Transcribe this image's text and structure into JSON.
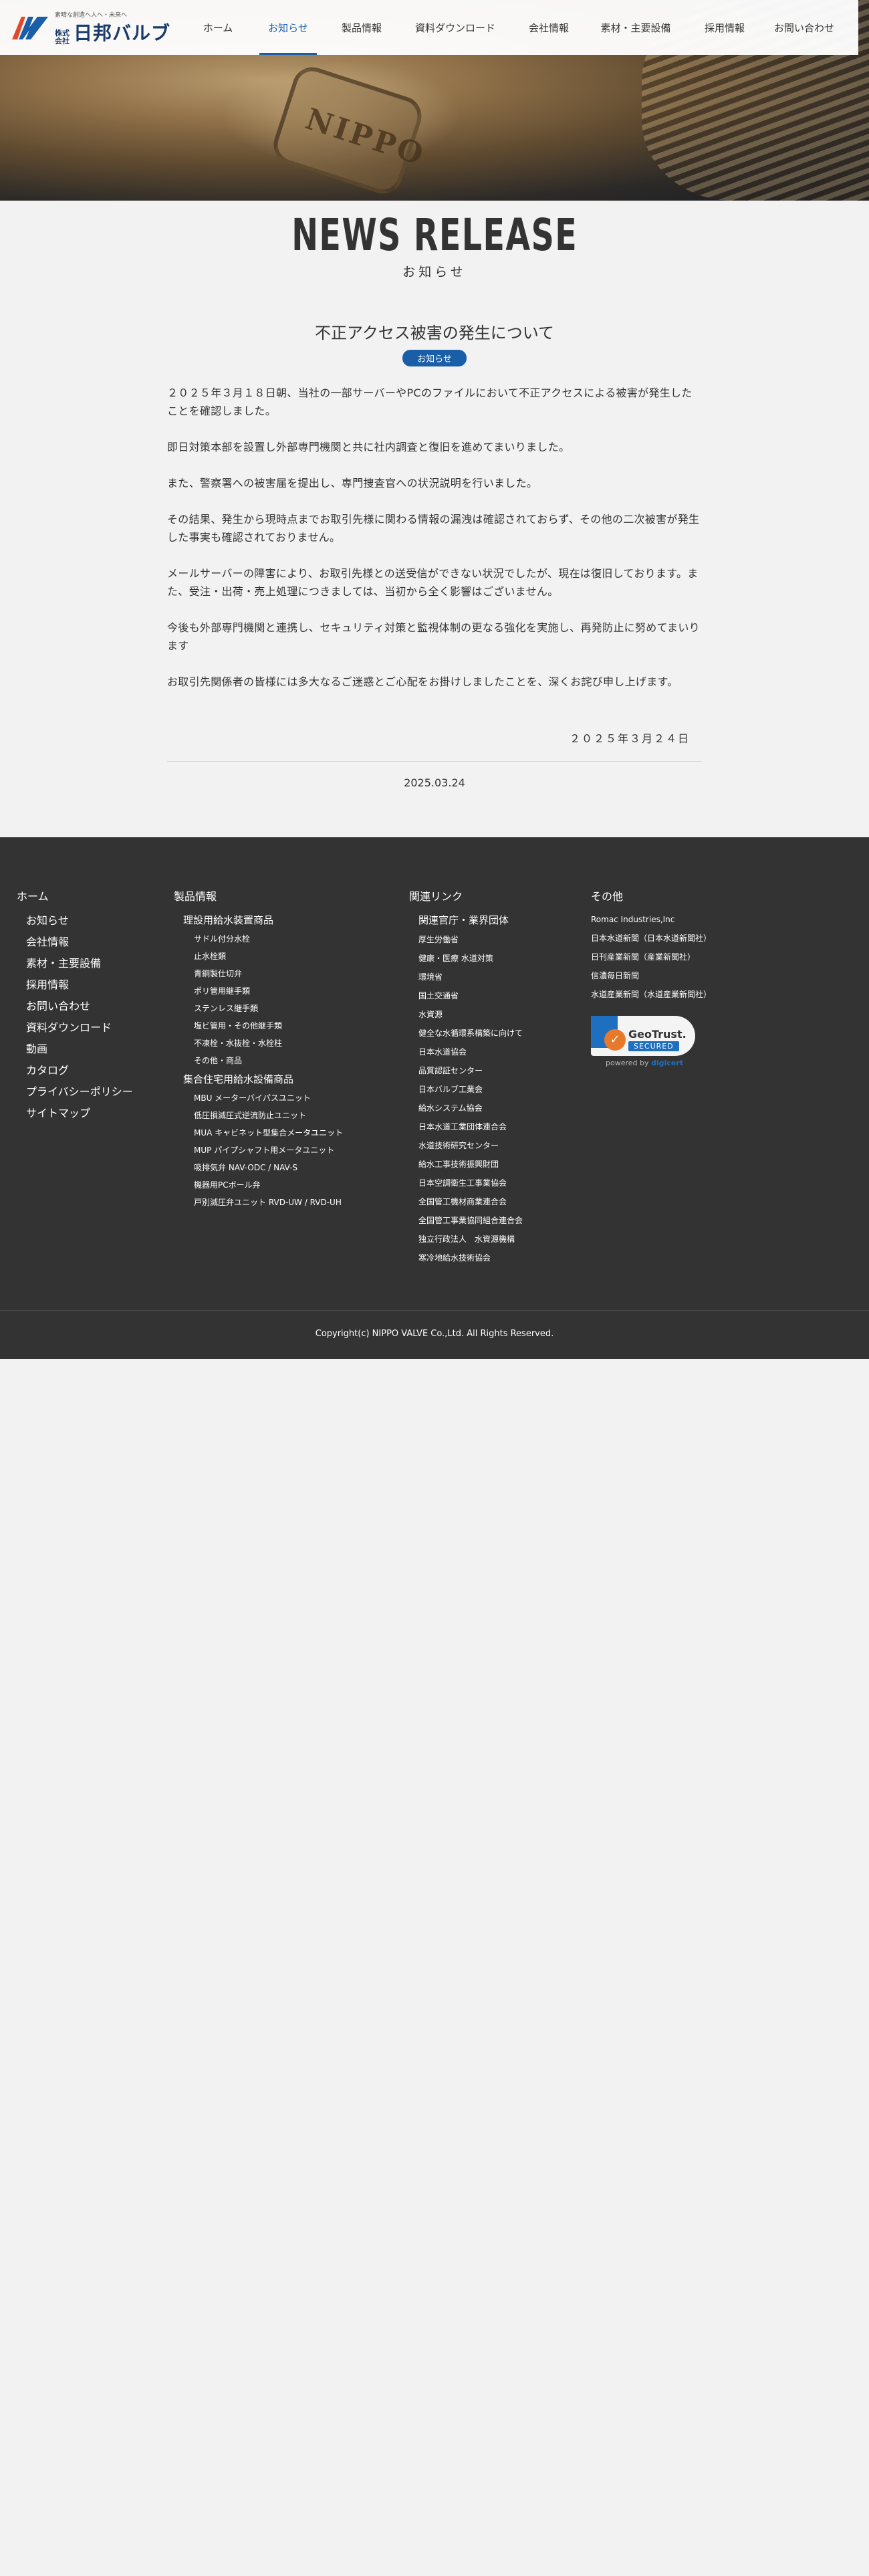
{
  "header": {
    "logo_tagline": "素晴な創造へ人へ・未来へ",
    "logo_kabu": "株式会社",
    "logo_name": "日邦バルブ",
    "hero_emboss": "NIPPO",
    "nav": [
      {
        "label": "ホーム",
        "active": false
      },
      {
        "label": "お知らせ",
        "active": true
      },
      {
        "label": "製品情報",
        "active": false
      },
      {
        "label": "資料ダウンロード",
        "active": false
      },
      {
        "label": "会社情報",
        "active": false
      },
      {
        "label": "素材・主要設備",
        "active": false
      },
      {
        "label": "採用情報",
        "active": false
      },
      {
        "label": "お問い合わせ",
        "active": false
      }
    ]
  },
  "page": {
    "title_en": "NEWS RELEASE",
    "title_ja": "お知らせ"
  },
  "article": {
    "title": "不正アクセス被害の発生について",
    "category": "お知らせ",
    "paragraphs": [
      "２０２５年３月１８日朝、当社の一部サーバーやPCのファイルにおいて不正アクセスによる被害が発生したことを確認しました。",
      "即日対策本部を設置し外部専門機関と共に社内調査と復旧を進めてまいりました。",
      "また、警察署への被害届を提出し、専門捜査官への状況説明を行いました。",
      "その結果、発生から現時点までお取引先様に関わる情報の漏洩は確認されておらず、その他の二次被害が発生した事実も確認されておりません。",
      "メールサーバーの障害により、お取引先様との送受信ができない状況でしたが、現在は復旧しております。また、受注・出荷・売上処理につきましては、当初から全く影響はございません。",
      "今後も外部専門機関と連携し、セキュリティ対策と監視体制の更なる強化を実施し、再発防止に努めてまいります",
      "お取引先関係者の皆様には多大なるご迷惑とご心配をお掛けしましたことを、深くお詫び申し上げます。"
    ],
    "signed_date": "２０２５年３月２４日",
    "post_date": "2025.03.24"
  },
  "footer": {
    "col1": {
      "head": "ホーム",
      "items": [
        "お知らせ",
        "会社情報",
        "素材・主要設備",
        "採用情報",
        "お問い合わせ",
        "資料ダウンロード",
        "動画",
        "カタログ",
        "プライバシーポリシー",
        "サイトマップ"
      ]
    },
    "col2": {
      "head": "製品情報",
      "group1": "理設用給水装置商品",
      "group1_items": [
        "サドル付分水栓",
        "止水栓類",
        "青銅製仕切弁",
        "ポリ管用継手類",
        "ステンレス継手類",
        "塩ビ管用・その他継手類",
        "不凍栓・水抜栓・水栓柱",
        "その他・商品"
      ],
      "group2": "集合住宅用給水設備商品",
      "group2_items": [
        "MBU メーターバイパスユニット",
        "低圧損減圧式逆流防止ユニット",
        "MUA キャビネット型集合メータユニット",
        "MUP パイプシャフト用メータユニット",
        "吸排気弁 NAV-ODC / NAV-S",
        "機器用PCボール弁",
        "戸別減圧弁ユニット RVD-UW / RVD-UH"
      ]
    },
    "col3": {
      "head": "関連リンク",
      "group": "関連官庁・業界団体",
      "items": [
        "厚生労働省",
        "健康・医療 水道対策",
        "環境省",
        "国土交通省",
        "水資源",
        "健全な水循環系構築に向けて",
        "日本水道協会",
        "品質認証センター",
        "日本バルブ工業会",
        "給水システム協会",
        "日本水道工業団体連合会",
        "水道技術研究センター",
        "給水工事技術振興財団",
        "日本空調衛生工事業協会",
        "全国管工機材商業連合会",
        "全国管工事業協同組合連合会",
        "独立行政法人　水資源機構",
        "寒冷地給水技術協会"
      ]
    },
    "col4": {
      "head": "その他",
      "items": [
        "Romac Industries,Inc",
        "日本水道新聞（日本水道新聞社）",
        "日刊産業新聞（産業新聞社）",
        "信濃毎日新聞",
        "水道産業新聞（水道産業新聞社）"
      ],
      "seal_name": "GeoTrust.",
      "seal_secured": "SECURED",
      "seal_powered": "powered by",
      "seal_brand": "digicert"
    },
    "copyright": "Copyright(c) NIPPO VALVE Co.,Ltd. All Rights Reserved."
  },
  "colors": {
    "accent": "#1b5ea8",
    "footer_bg": "#333333",
    "page_bg": "#f2f2f2"
  }
}
